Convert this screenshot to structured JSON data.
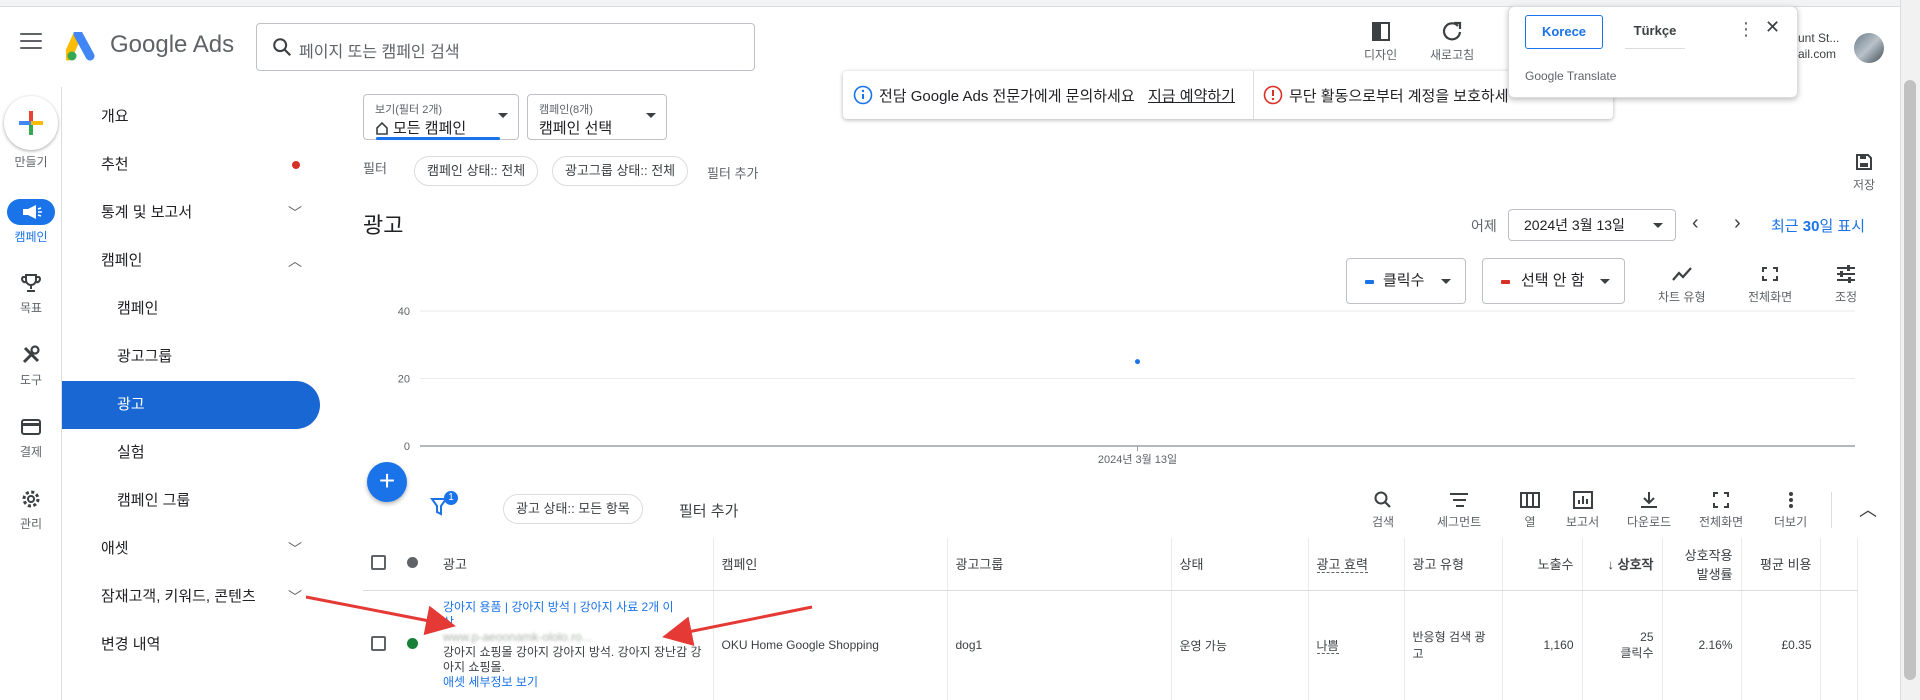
{
  "header": {
    "app_name": "Google Ads",
    "search_placeholder": "페이지 또는 캠페인 검색",
    "tools": [
      {
        "label": "디자인",
        "icon": "appearance-icon"
      },
      {
        "label": "새로고침",
        "icon": "refresh-icon"
      }
    ],
    "account_text_1": "unt St...",
    "account_text_2": "ail.com"
  },
  "translate_popup": {
    "lang_selected": "Korece",
    "lang_other": "Türkçe",
    "brand": "Google Translate"
  },
  "rail": {
    "create_label": "만들기",
    "items": [
      {
        "label": "캠페인",
        "icon": "megaphone-icon",
        "active": true
      },
      {
        "label": "목표",
        "icon": "trophy-icon"
      },
      {
        "label": "도구",
        "icon": "tools-icon"
      },
      {
        "label": "결제",
        "icon": "credit-card-icon"
      },
      {
        "label": "관리",
        "icon": "gear-icon"
      }
    ]
  },
  "nav": {
    "items": [
      {
        "label": "개요"
      },
      {
        "label": "추천",
        "badge": "red-dot"
      },
      {
        "label": "통계 및 보고서",
        "chevron": "down"
      },
      {
        "label": "캠페인",
        "chevron": "up"
      },
      {
        "label": "캠페인",
        "sub": true
      },
      {
        "label": "광고그룹",
        "sub": true
      },
      {
        "label": "광고",
        "sub": true,
        "active": true
      },
      {
        "label": "실험",
        "sub": true
      },
      {
        "label": "캠페인 그룹",
        "sub": true
      },
      {
        "label": "애셋",
        "chevron": "down"
      },
      {
        "label": "잠재고객, 키워드, 콘텐츠",
        "chevron": "down"
      },
      {
        "label": "변경 내역"
      }
    ]
  },
  "view_select": {
    "label": "보기(필터 2개)",
    "value": "모든 캠페인"
  },
  "campaign_select": {
    "label": "캠페인(8개)",
    "value": "캠페인 선택"
  },
  "notice": {
    "expert_text": "전담 Google Ads 전문가에게 문의하세요",
    "expert_link": "지금 예약하기",
    "protect_text": "무단 활동으로부터 계정을 보호하세"
  },
  "filters": {
    "label": "필터",
    "chips": [
      "캠페인 상태:: 전체",
      "광고그룹 상태:: 전체"
    ],
    "add": "필터 추가"
  },
  "save_label": "저장",
  "page_title": "광고",
  "date": {
    "prefix": "어제",
    "value": "2024년 3월 13일",
    "range_link_a": "최근 ",
    "range_link_b": "30",
    "range_link_c": "일 표시"
  },
  "metrics": [
    {
      "label": "클릭수",
      "color": "#1a73e8"
    },
    {
      "label": "선택 안 함",
      "color": "#d93025"
    }
  ],
  "chart_tools": [
    "차트 유형",
    "전체화면",
    "조정"
  ],
  "chart_data": {
    "type": "scatter",
    "x": [
      "2024년 3월 13일"
    ],
    "series": [
      {
        "values": [
          25
        ],
        "color": "#1a73e8"
      }
    ],
    "y_ticks": [
      "0",
      "20",
      "40"
    ],
    "ylim": [
      0,
      40
    ],
    "x_tick": "2024년 3월 13일",
    "grid": true
  },
  "table_filter": {
    "badge": "1",
    "chip": "광고 상태:: 모든 항목",
    "add": "필터 추가"
  },
  "table_tools": [
    "검색",
    "세그먼트",
    "열",
    "보고서",
    "다운로드",
    "전체화면",
    "더보기"
  ],
  "columns": [
    "광고",
    "캠페인",
    "광고그룹",
    "상태",
    "광고 효력",
    "광고 유형",
    "노출수",
    "상호작",
    "상호작용 발생률",
    "평균 비용"
  ],
  "row": {
    "headline_a": "강아지 용품 | 강아지 방석 | 강아지 사료  2개 이",
    "headline_b": "상",
    "url": "www.p-aeoonamk-ololo.ro...",
    "description": "강아지 쇼핑몰 강아지 강아지 방석. 강아지 장난감 강아지 쇼핑몰.",
    "details_link": "애셋 세부정보 보기",
    "campaign": "OKU Home Google Shopping",
    "ad_group": "dog1",
    "status": "운영 가능",
    "strength": "나쁨",
    "ad_type": "반응형 검색 광고",
    "impressions": "1,160",
    "interactions_value": "25",
    "interactions_unit": "클릭수",
    "interaction_rate": "2.16%",
    "avg_cost": "£0.35"
  }
}
